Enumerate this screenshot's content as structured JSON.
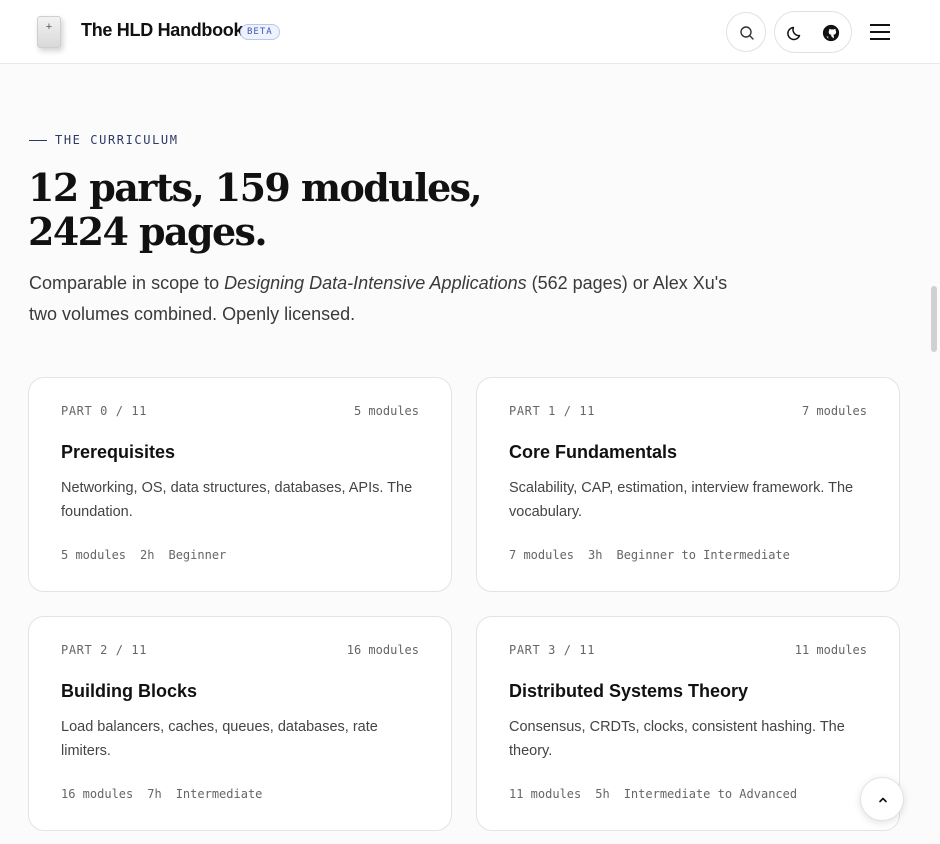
{
  "header": {
    "brand": "The HLD Handbook",
    "badge": "BETA",
    "search_icon": "search-icon",
    "theme_icon": "moon-icon",
    "github_icon": "github-icon",
    "menu_icon": "hamburger-menu-icon"
  },
  "hero": {
    "eyebrow": "THE CURRICULUM",
    "headline": "12 parts, 159 modules, 2424 pages.",
    "lede_before": "Comparable in scope to ",
    "lede_book": "Designing Data-Intensive Applications",
    "lede_after": " (562 pages) or Alex Xu's two volumes combined. Openly licensed."
  },
  "cards": [
    {
      "part": "PART 0 / 11",
      "count": "5 modules",
      "title": "Prerequisites",
      "desc": "Networking, OS, data structures, databases, APIs. The foundation.",
      "meta_modules": "5 modules",
      "meta_time": "2h",
      "meta_level": "Beginner"
    },
    {
      "part": "PART 1 / 11",
      "count": "7 modules",
      "title": "Core Fundamentals",
      "desc": "Scalability, CAP, estimation, interview framework. The vocabulary.",
      "meta_modules": "7 modules",
      "meta_time": "3h",
      "meta_level": "Beginner to Intermediate"
    },
    {
      "part": "PART 2 / 11",
      "count": "16 modules",
      "title": "Building Blocks",
      "desc": "Load balancers, caches, queues, databases, rate limiters.",
      "meta_modules": "16 modules",
      "meta_time": "7h",
      "meta_level": "Intermediate"
    },
    {
      "part": "PART 3 / 11",
      "count": "11 modules",
      "title": "Distributed Systems Theory",
      "desc": "Consensus, CRDTs, clocks, consistent hashing. The theory.",
      "meta_modules": "11 modules",
      "meta_time": "5h",
      "meta_level": "Intermediate to Advanced"
    }
  ],
  "scroll_top_icon": "chevron-up-icon"
}
